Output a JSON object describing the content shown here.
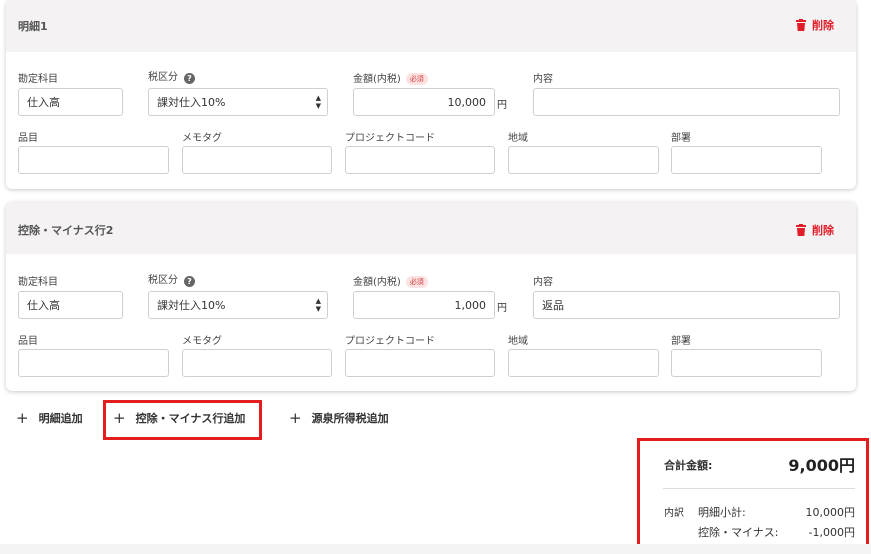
{
  "colors": {
    "accent_red": "#e11d2a",
    "header_bg": "#f4f2f2",
    "highlight_box": "#e11d1d"
  },
  "cards": [
    {
      "title": "明細1",
      "delete_label": "削除",
      "labels": {
        "account": "勘定科目",
        "tax": "税区分",
        "amount": "金額(内税)",
        "required": "必須",
        "content": "内容",
        "item": "品目",
        "memo": "メモタグ",
        "project": "プロジェクトコード",
        "region": "地域",
        "dept": "部署"
      },
      "values": {
        "account": "仕入高",
        "tax": "課対仕入10%",
        "amount": "10,000",
        "yen": "円",
        "content": "",
        "item": "",
        "memo": "",
        "project": "",
        "region": "",
        "dept": ""
      }
    },
    {
      "title": "控除・マイナス行2",
      "delete_label": "削除",
      "labels": {
        "account": "勘定科目",
        "tax": "税区分",
        "amount": "金額(内税)",
        "required": "必須",
        "content": "内容",
        "item": "品目",
        "memo": "メモタグ",
        "project": "プロジェクトコード",
        "region": "地域",
        "dept": "部署"
      },
      "values": {
        "account": "仕入高",
        "tax": "課対仕入10%",
        "amount": "1,000",
        "yen": "円",
        "content": "返品",
        "item": "",
        "memo": "",
        "project": "",
        "region": "",
        "dept": ""
      }
    }
  ],
  "actions": {
    "add_detail": "明細追加",
    "add_deduction": "控除・マイナス行追加",
    "add_withholding": "源泉所得税追加"
  },
  "summary": {
    "total_label": "合計金額:",
    "total_value": "9,000円",
    "breakdown_label": "内訳",
    "subtotal_label": "明細小計:",
    "subtotal_value": "10,000円",
    "deduction_label": "控除・マイナス:",
    "deduction_value": "-1,000円"
  },
  "icons": {
    "delete": "trash-icon",
    "help": "help-circle-icon",
    "add": "plus-icon",
    "select": "caret-updown-icon"
  }
}
